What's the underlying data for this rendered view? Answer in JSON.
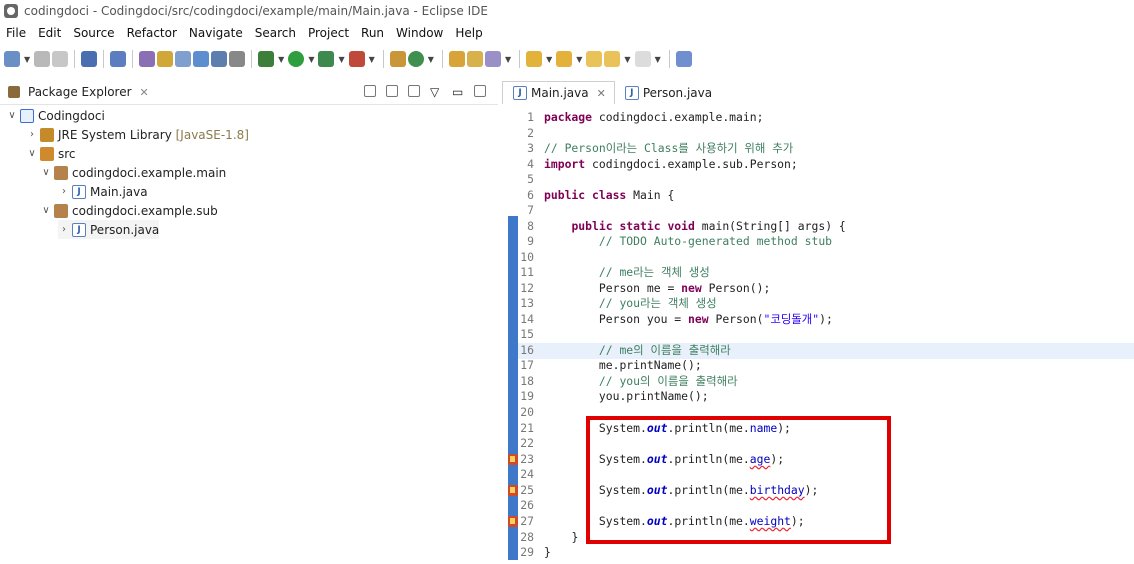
{
  "window": {
    "title": "codingdoci - Codingdoci/src/codingdoci/example/main/Main.java - Eclipse IDE"
  },
  "menu": [
    "File",
    "Edit",
    "Source",
    "Refactor",
    "Navigate",
    "Search",
    "Project",
    "Run",
    "Window",
    "Help"
  ],
  "package_explorer": {
    "title": "Package Explorer",
    "close": "✕",
    "tree": [
      {
        "label": "Codingdoci",
        "extra": ""
      },
      {
        "label": "JRE System Library",
        "extra": "[JavaSE-1.8]"
      },
      {
        "label": "src",
        "extra": ""
      },
      {
        "label": "codingdoci.example.main",
        "extra": ""
      },
      {
        "label": "Main.java",
        "extra": ""
      },
      {
        "label": "codingdoci.example.sub",
        "extra": ""
      },
      {
        "label": "Person.java",
        "extra": ""
      }
    ]
  },
  "editor": {
    "tabs": [
      {
        "label": "Main.java",
        "close": "✕"
      },
      {
        "label": "Person.java"
      }
    ],
    "lines": [
      "1",
      "2",
      "3",
      "4",
      "5",
      "6",
      "7",
      "8",
      "9",
      "10",
      "11",
      "12",
      "13",
      "14",
      "15",
      "16",
      "17",
      "18",
      "19",
      "20",
      "21",
      "22",
      "23",
      "24",
      "25",
      "26",
      "27",
      "28",
      "29"
    ],
    "code": {
      "l1_kw": "package",
      "l1_rest": " codingdoci.example.main;",
      "l3": "// Person이라는 Class를 사용하기 위해 추가",
      "l4_kw": "import",
      "l4_rest": " codingdoci.example.sub.Person;",
      "l6_kw": "public class",
      "l6_rest": " Main {",
      "l8_kw": "public static void",
      "l8_rest": " main(String[] args) {",
      "l9": "// TODO Auto-generated method stub",
      "l11": "// me라는 객체 생성",
      "l12_a": "Person me = ",
      "l12_kw": "new",
      "l12_b": " Person();",
      "l13": "// you라는 객체 생성",
      "l14_a": "Person you = ",
      "l14_kw": "new",
      "l14_b": " Person(",
      "l14_str": "\"코딩돌개\"",
      "l14_c": ");",
      "l16": "// me의 이름을 출력해라",
      "l17": "me.printName();",
      "l18": "// you의 이름을 출력해라",
      "l19": "you.printName();",
      "sys": "System.",
      "out": "out",
      "println": ".println(me.",
      "close": ");",
      "f21": "name",
      "f23": "age",
      "f25": "birthday",
      "f27": "weight",
      "l28": "}",
      "l29": "}"
    }
  }
}
